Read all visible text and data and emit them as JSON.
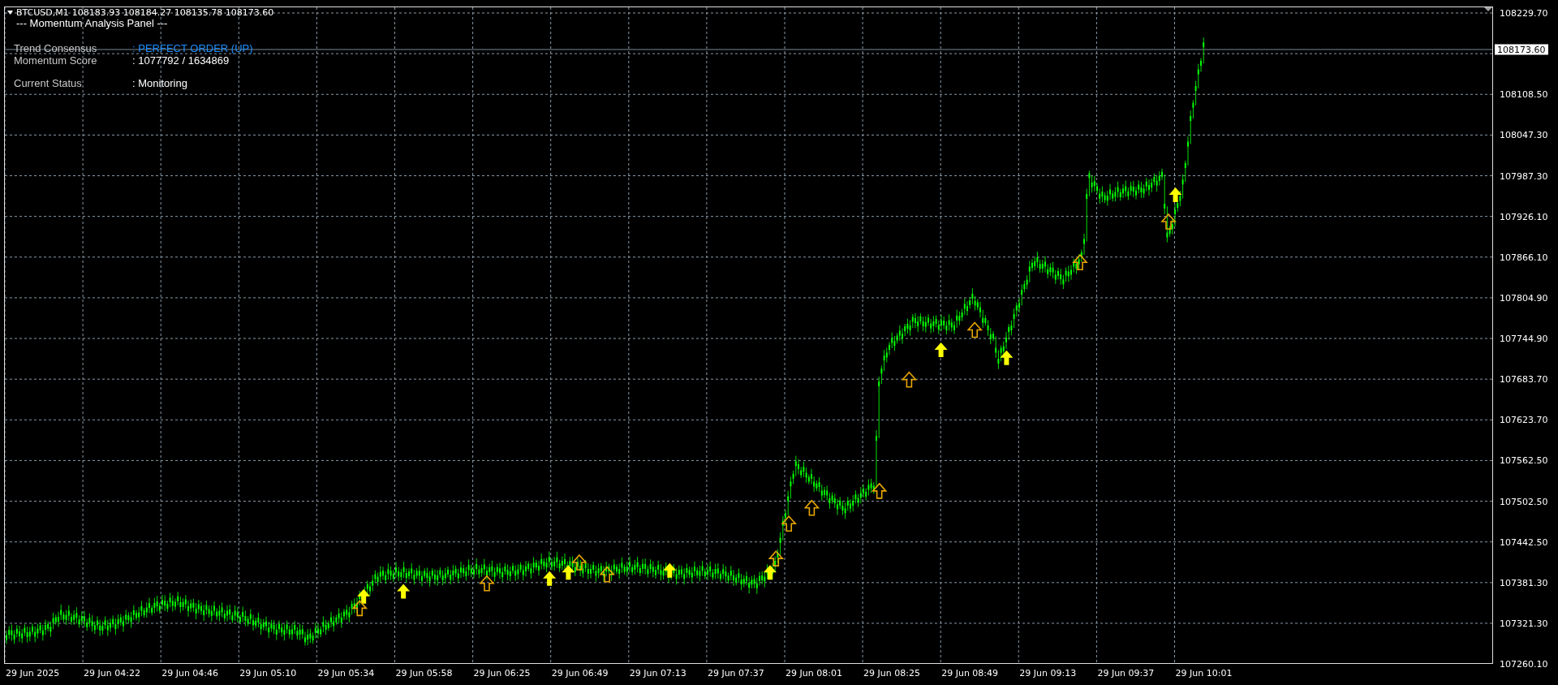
{
  "chart_header": {
    "symbol": "BTCUSD,M1",
    "quotes": "108183.93 108184.27 108135.78 108173.60"
  },
  "panel": {
    "title": "--- Momentum Analysis Panel ---",
    "rows": [
      {
        "label": "Trend Consensus",
        "value": ": PERFECT ORDER (UP)",
        "color": "#1e90ff"
      },
      {
        "label": "Momentum Score",
        "value": ": 1077792 / 1634869",
        "color": "#ffffff"
      },
      {
        "label": "Current Status",
        "value": ": Monitoring",
        "color": "#ffffff",
        "gap": true
      }
    ]
  },
  "price_axis": [
    "108229.70",
    "108108.50",
    "108047.30",
    "107987.30",
    "107926.10",
    "107866.10",
    "107804.90",
    "107744.90",
    "107683.70",
    "107623.70",
    "107562.50",
    "107502.50",
    "107442.50",
    "107381.30",
    "107321.30",
    "107260.10"
  ],
  "current_price": "108173.60",
  "time_axis": [
    "29 Jun 2025",
    "29 Jun 04:22",
    "29 Jun 04:46",
    "29 Jun 05:10",
    "29 Jun 05:34",
    "29 Jun 05:58",
    "29 Jun 06:25",
    "29 Jun 06:49",
    "29 Jun 07:13",
    "29 Jun 07:37",
    "29 Jun 08:01",
    "29 Jun 08:25",
    "29 Jun 08:49",
    "29 Jun 09:13",
    "29 Jun 09:37",
    "29 Jun 10:01"
  ]
}
